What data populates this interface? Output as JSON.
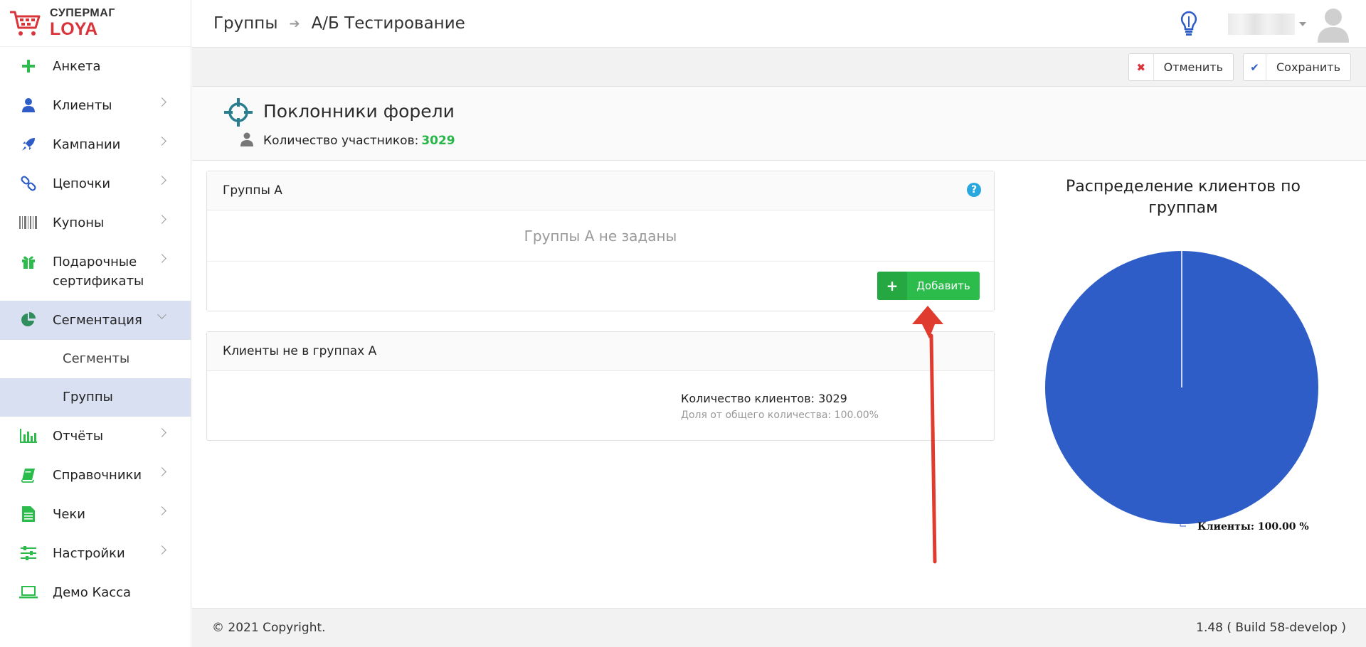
{
  "logo": {
    "top": "СУПЕРМАГ",
    "bottom": "LOYA"
  },
  "sidebar": {
    "items": [
      {
        "label": "Анкета",
        "icon": "plus-icon",
        "color": "#2cbc4c"
      },
      {
        "label": "Клиенты",
        "icon": "user-icon",
        "color": "#2f5dc7"
      },
      {
        "label": "Кампании",
        "icon": "rocket-icon",
        "color": "#2f5dc7"
      },
      {
        "label": "Цепочки",
        "icon": "link-icon",
        "color": "#2f5dc7"
      },
      {
        "label": "Купоны",
        "icon": "barcode-icon",
        "color": "#777777"
      },
      {
        "label": "Подарочные сертификаты",
        "icon": "gift-icon",
        "color": "#2cbc4c"
      },
      {
        "label": "Сегментация",
        "icon": "pie-icon",
        "color": "#2f5dc7"
      },
      {
        "label": "Отчёты",
        "icon": "bar-chart-icon",
        "color": "#2cbc4c"
      },
      {
        "label": "Справочники",
        "icon": "book-icon",
        "color": "#2cbc4c"
      },
      {
        "label": "Чеки",
        "icon": "document-icon",
        "color": "#2cbc4c"
      },
      {
        "label": "Настройки",
        "icon": "sliders-icon",
        "color": "#2cbc4c"
      },
      {
        "label": "Демо Касса",
        "icon": "laptop-icon",
        "color": "#2cbc4c"
      }
    ],
    "sub_items": [
      {
        "label": "Сегменты"
      },
      {
        "label": "Группы"
      }
    ]
  },
  "header": {
    "breadcrumb": [
      "Группы",
      "А/Б Тестирование"
    ]
  },
  "toolbar": {
    "cancel_label": "Отменить",
    "save_label": "Сохранить"
  },
  "group": {
    "title": "Поклонники форели",
    "members_label": "Количество участников:",
    "members_count": "3029"
  },
  "groups_a": {
    "title": "Группы А",
    "empty": "Группы А не заданы",
    "add_label": "Добавить"
  },
  "not_in_groups": {
    "title": "Клиенты не в группах А",
    "count_label": "Количество клиентов:",
    "count": "3029",
    "share": "Доля от общего количества: 100.00%"
  },
  "chart": {
    "title": "Распределение клиентов по группам"
  },
  "chart_data": {
    "type": "pie",
    "title": "Распределение клиентов по группам",
    "slices": [
      {
        "label": "Клиенты",
        "value": 100.0
      }
    ],
    "data_label": "Клиенты: 100.00 %",
    "colors": [
      "#2f5dc7"
    ]
  },
  "footer": {
    "copyright": "© 2021 Copyright.",
    "version": "1.48 ( Build 58-develop )"
  },
  "colors": {
    "accent_green": "#2cbc4c",
    "accent_blue": "#2f5dc7",
    "brand_red": "#d9343a",
    "active_bg": "#d8e0f2"
  }
}
